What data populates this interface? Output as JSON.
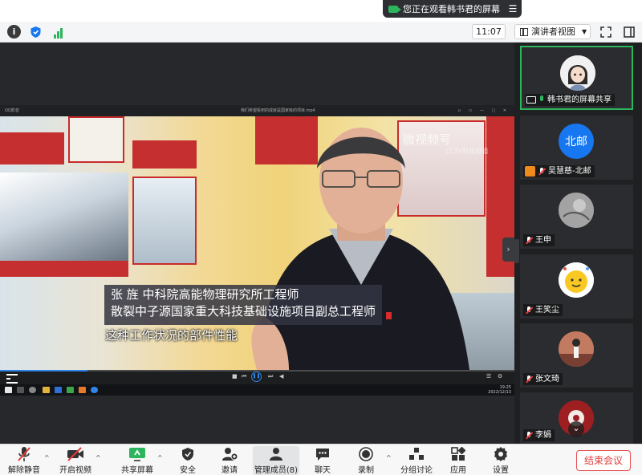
{
  "top_banner": {
    "text": "您正在观看韩书君的屏幕"
  },
  "toolbar": {
    "time": "11:07",
    "view_mode": "演讲者视图"
  },
  "player": {
    "title_left": "QQ影音",
    "title_mid": "我们希望看到的成就是国家级的项目.mp4",
    "caption_line1": "张  旌  中科院高能物理研究所工程师",
    "caption_line2": "散裂中子源国家重大科技基础设施项目副总工程师",
    "subtitle": "这种工作状况的部件性能",
    "watermark": "微视频号",
    "watermark_sub": "CCTV科技频道",
    "progress": 0.17,
    "clock_time": "19:25",
    "clock_date": "2022/12/13"
  },
  "gallery": [
    {
      "name": "韩书君的屏幕共享",
      "avatar": "cartoon-girl",
      "status": "sharing",
      "active": true
    },
    {
      "name": "吴慧慈-北邮",
      "avatar_text": "北邮",
      "avatar_color": "#1677f0",
      "status": "muted",
      "badge": "orange"
    },
    {
      "name": "王申",
      "avatar": "gray-sketch",
      "status": "muted"
    },
    {
      "name": "王笑尘",
      "avatar": "yellow-face",
      "status": "muted"
    },
    {
      "name": "张文琦",
      "avatar": "photo-person",
      "status": "muted"
    },
    {
      "name": "李娟",
      "avatar": "red-floral",
      "status": "muted"
    }
  ],
  "bottom_bar": {
    "unmute": "解除静音",
    "start_video": "开启视频",
    "share_screen": "共享屏幕",
    "security": "安全",
    "invite": "邀请",
    "manage_members": "管理成员(8)",
    "chat": "聊天",
    "record": "录制",
    "breakout": "分组讨论",
    "apps": "应用",
    "settings": "设置",
    "end_meeting": "结束会议"
  },
  "colors": {
    "accent_green": "#2db55d",
    "end_red": "#e04040",
    "highlight_blue": "#1677f0"
  }
}
